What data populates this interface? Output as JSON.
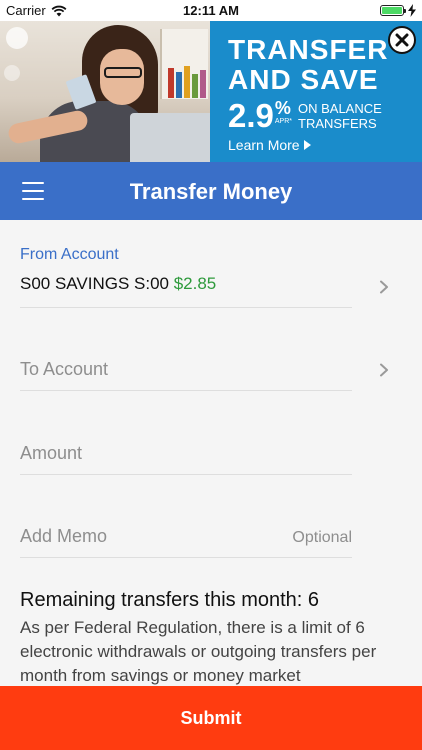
{
  "status_bar": {
    "carrier": "Carrier",
    "time": "12:11 AM"
  },
  "ad": {
    "headline_line1": "TRANSFER",
    "headline_line2": "AND SAVE",
    "rate": "2.9",
    "percent": "%",
    "apr": "APR*",
    "balance_line1": "ON BALANCE",
    "balance_line2": "TRANSFERS",
    "learn_more": "Learn More",
    "color_blue": "#1a8ccb",
    "close_icon": "close-icon"
  },
  "nav": {
    "title": "Transfer Money",
    "color": "#3a6fc8",
    "menu_icon": "hamburger-icon"
  },
  "form": {
    "from_account": {
      "label": "From Account",
      "account_name": "S00 SAVINGS S:00",
      "balance": "$2.85"
    },
    "to_account": {
      "placeholder": "To Account"
    },
    "amount": {
      "placeholder": "Amount"
    },
    "memo": {
      "placeholder": "Add Memo",
      "hint": "Optional"
    },
    "remaining": "Remaining transfers this month: 6",
    "regulation": "As per Federal Regulation, there is a limit of 6 electronic withdrawals or outgoing transfers per month from savings or money market"
  },
  "submit": {
    "label": "Submit",
    "color": "#ff3c10"
  }
}
